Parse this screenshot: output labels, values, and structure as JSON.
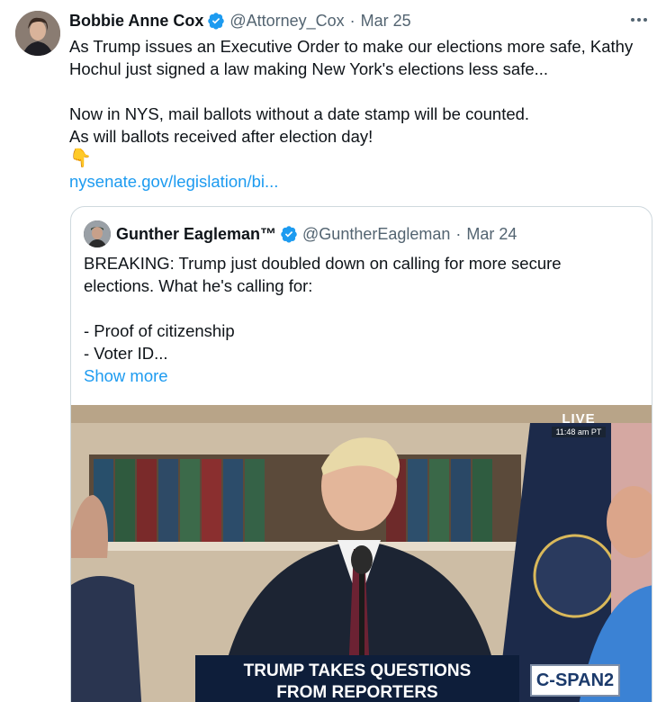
{
  "tweet": {
    "author_name": "Bobbie Anne Cox",
    "author_handle": "@Attorney_Cox",
    "date": "Mar 25",
    "lines": [
      "As Trump issues an Executive Order to make our elections more safe, Kathy",
      "Hochul just signed a law making New York's elections less safe...",
      "Now in NYS, mail ballots without a date stamp will be counted.",
      "As will ballots received after election day!"
    ],
    "emoji": "👇",
    "link_text": "nysenate.gov/legislation/bi..."
  },
  "quoted": {
    "author_name": "Gunther Eagleman™",
    "author_handle": "@GuntherEagleman",
    "date": "Mar 24",
    "lines": [
      "BREAKING: Trump just doubled down on calling for more secure",
      "elections. What he's calling for:",
      "- Proof of citizenship",
      "- Voter ID..."
    ],
    "show_more": "Show more"
  },
  "media": {
    "live_label": "LIVE",
    "live_time": "11:48 am PT",
    "caption_line1": "TRUMP TAKES QUESTIONS",
    "caption_line2": "FROM REPORTERS",
    "network_logo": "C-SPAN2"
  },
  "colors": {
    "link": "#1d9bf0",
    "verified": "#1d9bf0",
    "muted": "#536471",
    "border": "#cfd9de"
  },
  "icons": {
    "verified": "verified-badge-icon",
    "more": "more-options-icon"
  }
}
